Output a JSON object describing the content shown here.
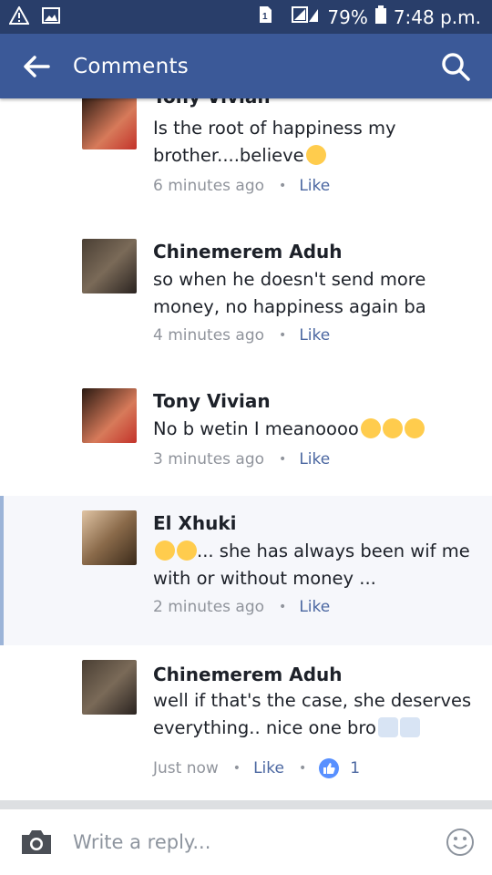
{
  "status_bar": {
    "battery": "79%",
    "time": "7:48 p.m."
  },
  "app_bar": {
    "title": "Comments"
  },
  "comments": [
    {
      "name": "Tony Vivian",
      "text": "Is the root of happiness my brother....believe",
      "emoji": "😊",
      "time": "6 minutes ago",
      "like": "Like"
    },
    {
      "name": "Chinemerem Aduh",
      "text": "so when he doesn't send more money, no happiness again ba",
      "time": "4 minutes ago",
      "like": "Like"
    },
    {
      "name": "Tony Vivian",
      "text": "No b wetin I meanoooo",
      "emoji": "🥴🥴🥴",
      "time": "3 minutes ago",
      "like": "Like"
    },
    {
      "name": "El Xhuki",
      "emoji_prefix": "🤣🤣",
      "text": "... she has always been wif me with or without money ...",
      "time": "2 minutes ago",
      "like": "Like"
    },
    {
      "name": "Chinemerem Aduh",
      "text": "well if that's the case, she deserves everything.. nice one bro",
      "emoji": "👏👏",
      "time": "Just now",
      "like": "Like",
      "reaction_count": "1"
    }
  ],
  "composer": {
    "placeholder": "Write a reply..."
  },
  "colors": {
    "status_bar": "#293e6a",
    "app_bar": "#3b5998",
    "link": "#4b67a1"
  }
}
